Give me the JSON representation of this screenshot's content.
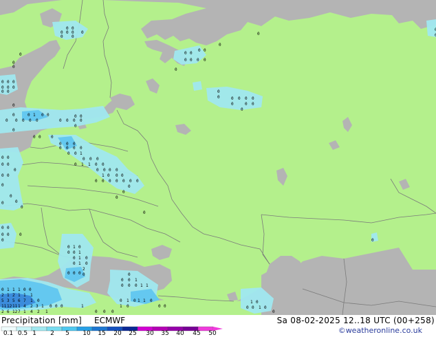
{
  "title": {
    "product": "Precipitation [mm]",
    "model": "ECMWF",
    "valid_time": "Sa 08-02-2025 12..18 UTC (00+258)",
    "credit": "©weatheronline.co.uk"
  },
  "colors": {
    "land": "#b4f08c",
    "sea": "#b4b4b4",
    "border": "#7a7a7a",
    "coast": "#9a9a9a",
    "precip_light": "#a0e8f0",
    "precip_medium": "#64c8f0",
    "precip_heavy": "#3c8cdc"
  },
  "legend": {
    "ticks": [
      "0.1",
      "0.5",
      "1",
      "2",
      "5",
      "10",
      "15",
      "20",
      "25",
      "30",
      "35",
      "40",
      "45",
      "50"
    ],
    "colors": [
      "#f0fcfc",
      "#c8f4f8",
      "#a0e8f0",
      "#78dcf0",
      "#50c8f0",
      "#28a0e6",
      "#1e78d2",
      "#1450be",
      "#0a2896",
      "#d200d2",
      "#b400b4",
      "#9600aa",
      "#780096",
      "#f03cdc"
    ]
  },
  "precip_values": [
    "0",
    "1",
    "2",
    "3",
    "4",
    "5",
    "6",
    "7",
    "8",
    "11",
    "12"
  ]
}
